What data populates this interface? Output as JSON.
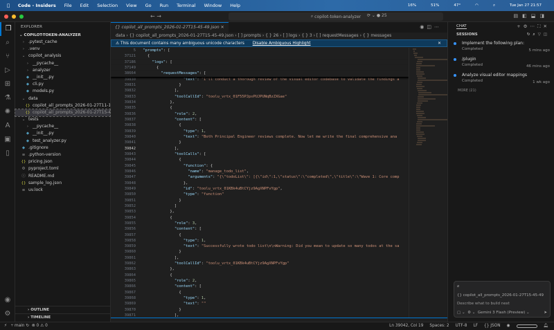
{
  "menubar": {
    "app": "Code - Insiders",
    "items": [
      "File",
      "Edit",
      "Selection",
      "View",
      "Go",
      "Run",
      "Terminal",
      "Window",
      "Help"
    ],
    "status": [
      "16%",
      "51%",
      "47°",
      "Tue Jan 27  21:57"
    ]
  },
  "titlebar": {
    "search": "copilot-token-analyzer",
    "badge": "25"
  },
  "explorer": {
    "title": "EXPLORER",
    "root": "COPILOT-TOKEN-ANALYZER",
    "items": [
      {
        "label": ".pytest_cache",
        "icon": "›",
        "depth": 1
      },
      {
        "label": ".venv",
        "icon": "›",
        "depth": 1
      },
      {
        "label": "copilot_analysis",
        "icon": "⌄",
        "depth": 1
      },
      {
        "label": "__pycache__",
        "icon": "›",
        "depth": 2
      },
      {
        "label": "analyzer",
        "icon": "›",
        "depth": 2
      },
      {
        "label": "__init__.py",
        "icon": "◆",
        "depth": 2
      },
      {
        "label": "cli.py",
        "icon": "◆",
        "depth": 2
      },
      {
        "label": "models.py",
        "icon": "◆",
        "depth": 2
      },
      {
        "label": "data",
        "icon": "⌄",
        "depth": 1
      },
      {
        "label": "copilot_all_prompts_2026-01-27T11-17-...",
        "icon": "{}",
        "depth": 2
      },
      {
        "label": "copilot_all_prompts_2026-01-27T15-45-...",
        "icon": "{}",
        "depth": 2,
        "selected": true
      },
      {
        "label": "tests",
        "icon": "⌄",
        "depth": 1
      },
      {
        "label": "__pycache__",
        "icon": "›",
        "depth": 2
      },
      {
        "label": "__init__.py",
        "icon": "◆",
        "depth": 2
      },
      {
        "label": "test_analyzer.py",
        "icon": "◆",
        "depth": 2
      },
      {
        "label": ".gitignore",
        "icon": "◆",
        "depth": 1
      },
      {
        "label": ".python-version",
        "icon": "≡",
        "depth": 1
      },
      {
        "label": "pricing.json",
        "icon": "{}",
        "depth": 1
      },
      {
        "label": "pyproject.toml",
        "icon": "⚙",
        "depth": 1
      },
      {
        "label": "README.md",
        "icon": "ⓘ",
        "depth": 1
      },
      {
        "label": "sample_log.json",
        "icon": "{}",
        "depth": 1
      },
      {
        "label": "uv.lock",
        "icon": "≡",
        "depth": 1
      }
    ],
    "outline": "OUTLINE",
    "timeline": "TIMELINE"
  },
  "editor": {
    "tab": "{} copilot_all_prompts_2026-01-27T15-45-49.json",
    "breadcrumb": "data › {} copilot_all_prompts_2026-01-27T15-45-49.json › [ ] prompts › { } 26 › [ ] logs › { } 3 › [ ] requestMessages › { } messages",
    "banner": "This document contains many ambiguous unicode characters",
    "banner_action": "Disable Ambiguous Highlight",
    "current_line": 39842,
    "lines": [
      {
        "n": 5,
        "t": "  \"prompts\": [",
        "sticky": true
      },
      {
        "n": 37121,
        "t": "    {",
        "sticky": true
      },
      {
        "n": 37186,
        "t": "      \"logs\": [",
        "sticky": true
      },
      {
        "n": 37149,
        "t": "        {",
        "sticky": true
      },
      {
        "n": 38664,
        "t": "          \"requestMessages\": [",
        "sticky": true
      },
      {
        "n": 39830,
        "t": "                    \"text\": \"I'll conduct a thorough review of the visual editor codebase to validate the findings a"
      },
      {
        "n": 39831,
        "t": "                  }"
      },
      {
        "n": 39832,
        "t": "                ],"
      },
      {
        "n": 39833,
        "t": "                \"toolCallId\": \"toolu_vrtx_01F55PJpxPUJPUNqBzZXGae\""
      },
      {
        "n": 39834,
        "t": "              },"
      },
      {
        "n": 39835,
        "t": "              {"
      },
      {
        "n": 39836,
        "t": "                \"role\": 2,"
      },
      {
        "n": 39837,
        "t": "                \"content\": ["
      },
      {
        "n": 39838,
        "t": "                  {"
      },
      {
        "n": 39839,
        "t": "                    \"type\": 1,"
      },
      {
        "n": 39840,
        "t": "                    \"text\": \"Both Principal Engineer reviews complete. Now let me write the final comprehensive ana"
      },
      {
        "n": 39841,
        "t": "                  }"
      },
      {
        "n": 39842,
        "t": "                ],"
      },
      {
        "n": 39843,
        "t": "                \"toolCalls\": ["
      },
      {
        "n": 39844,
        "t": "                  {"
      },
      {
        "n": 39845,
        "t": "                    \"function\": {"
      },
      {
        "n": 39846,
        "t": "                      \"name\": \"manage_todo_list\","
      },
      {
        "n": 39847,
        "t": "                      \"arguments\": \"{\\\"todoList\\\": [{\\\"id\\\":1,\\\"status\\\":\\\"completed\\\",\\\"title\\\":\\\"Wave 1: Core comp"
      },
      {
        "n": 39848,
        "t": "                    },"
      },
      {
        "n": 39849,
        "t": "                    \"id\": \"toolu_vrtx_01KBk4uBtCYjz9AgXNPFvYgp\","
      },
      {
        "n": 39850,
        "t": "                    \"type\": \"function\""
      },
      {
        "n": 39851,
        "t": "                  }"
      },
      {
        "n": 39852,
        "t": "                ]"
      },
      {
        "n": 39853,
        "t": "              },"
      },
      {
        "n": 39854,
        "t": "              {"
      },
      {
        "n": 39855,
        "t": "                \"role\": 3,"
      },
      {
        "n": 39856,
        "t": "                \"content\": ["
      },
      {
        "n": 39857,
        "t": "                  {"
      },
      {
        "n": 39858,
        "t": "                    \"type\": 1,"
      },
      {
        "n": 39859,
        "t": "                    \"text\": \"Successfully wrote todo list\\n\\nWarning: Did you mean to update so many todos at the sa"
      },
      {
        "n": 39860,
        "t": "                  }"
      },
      {
        "n": 39861,
        "t": "                ],"
      },
      {
        "n": 39862,
        "t": "                \"toolCallId\": \"toolu_vrtx_01KBk4uBtCYjz9AgXNPFvYgp\""
      },
      {
        "n": 39863,
        "t": "              },"
      },
      {
        "n": 39864,
        "t": "              {"
      },
      {
        "n": 39865,
        "t": "                \"role\": 2,"
      },
      {
        "n": 39866,
        "t": "                \"content\": ["
      },
      {
        "n": 39867,
        "t": "                  {"
      },
      {
        "n": 39868,
        "t": "                    \"type\": 1,"
      },
      {
        "n": 39869,
        "t": "                    \"text\": \"\""
      },
      {
        "n": 39870,
        "t": "                  }"
      },
      {
        "n": 39871,
        "t": "                ],"
      }
    ]
  },
  "chat": {
    "title": "CHAT",
    "sessions_title": "SESSIONS",
    "sessions": [
      {
        "title": "Implement the following plan:",
        "status": "Completed",
        "ago": "5 mins ago"
      },
      {
        "title": "/plugin",
        "status": "Completed",
        "ago": "46 mins ago"
      },
      {
        "title": "Analyze visual editor mappings",
        "status": "Completed",
        "ago": "1 wk ago"
      }
    ],
    "more": "MORE (21)",
    "attachment": "{} copilot_all_prompts_2026-01-27T15-45-49",
    "placeholder": "Describe what to build next",
    "model": "Gemini 3 Flash (Preview)"
  },
  "statusbar": {
    "branch": "main",
    "errors": "0",
    "warnings": "0",
    "position": "Ln 39042, Col 19",
    "spaces": "Spaces: 2",
    "encoding": "UTF-8",
    "eol": "LF",
    "language": "JSON"
  },
  "colors": {
    "accent": "#0078d4",
    "key": "#9cdcfe",
    "string": "#ce9178",
    "number": "#b5cea8",
    "banner": "#0e3a5c"
  }
}
